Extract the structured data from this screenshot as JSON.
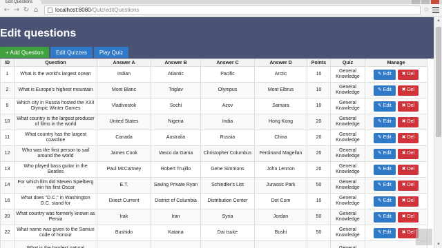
{
  "browser": {
    "tab_title": "Edit Questions",
    "url_host": "localhost:8080",
    "url_path": "/Quiz/editQuestions"
  },
  "header": {
    "title": "Edit questions",
    "add_button": "+ Add Question",
    "edit_quizzes_button": "Edit Quizzes",
    "play_quiz_button": "Play Quiz"
  },
  "table": {
    "columns": [
      "ID",
      "Question",
      "Answer A",
      "Answer B",
      "Answer C",
      "Answer D",
      "Points",
      "Quiz",
      "Manage"
    ],
    "edit_label": "✎ Edit",
    "del_label": "✖ Del",
    "rows": [
      {
        "id": "1",
        "question": "What is the world's largest ocean",
        "a": "Indian",
        "b": "Atlantic",
        "c": "Pacific",
        "d": "Arctic",
        "points": "10",
        "quiz": "General Knowledge"
      },
      {
        "id": "2",
        "question": "What is Europe's highest mountain",
        "a": "Mont Blanc",
        "b": "Triglav",
        "c": "Olympus",
        "d": "Mont Elbrus",
        "points": "10",
        "quiz": "General Knowledge"
      },
      {
        "id": "9",
        "question": "Which city in Russia hosted the XXII Olympic Winter Games",
        "a": "Vladivostok",
        "b": "Sochi",
        "c": "Azov",
        "d": "Samara",
        "points": "10",
        "quiz": "General Knowledge"
      },
      {
        "id": "10",
        "question": "What country is the largest producer of films in the world",
        "a": "United States",
        "b": "Nigeria",
        "c": "India",
        "d": "Hong Kong",
        "points": "20",
        "quiz": "General Knowledge"
      },
      {
        "id": "11",
        "question": "What country has the largest coastline",
        "a": "Canada",
        "b": "Australia",
        "c": "Russia",
        "d": "China",
        "points": "20",
        "quiz": "General Knowledge"
      },
      {
        "id": "12",
        "question": "Who was the first person to sail around the world",
        "a": "James Cook",
        "b": "Vasco da Gama",
        "c": "Christopher Columbus",
        "d": "Ferdinand Magellan",
        "points": "20",
        "quiz": "General Knowledge"
      },
      {
        "id": "13",
        "question": "Who played bass guitar in the Beatles",
        "a": "Paul McCartney",
        "b": "Robert Trujillo",
        "c": "Gene Simmons",
        "d": "John Lennon",
        "points": "20",
        "quiz": "General Knowledge"
      },
      {
        "id": "14",
        "question": "For which film did Steven Spielberg win his first Oscar",
        "a": "E.T.",
        "b": "Saving Private Ryan",
        "c": "Schindler's List",
        "d": "Jurassic Park",
        "points": "50",
        "quiz": "General Knowledge"
      },
      {
        "id": "16",
        "question": "What does \"D.C.\" in Washington D.C. stand for",
        "a": "Direct Current",
        "b": "District of Columbia",
        "c": "Distribution Center",
        "d": "Dot Com",
        "points": "10",
        "quiz": "General Knowledge"
      },
      {
        "id": "20",
        "question": "What country was formerly known as Persia",
        "a": "Irak",
        "b": "Iran",
        "c": "Syria",
        "d": "Jordan",
        "points": "50",
        "quiz": "General Knowledge"
      },
      {
        "id": "22",
        "question": "What name was given to the Samuri code of honour",
        "a": "Bushido",
        "b": "Katana",
        "c": "Dai tsuke",
        "d": "Bushi",
        "points": "50",
        "quiz": "General Knowledge"
      },
      {
        "id": "",
        "question": "What is the hardest natural",
        "a": "",
        "b": "",
        "c": "",
        "d": "",
        "points": "",
        "quiz": "General"
      }
    ]
  }
}
